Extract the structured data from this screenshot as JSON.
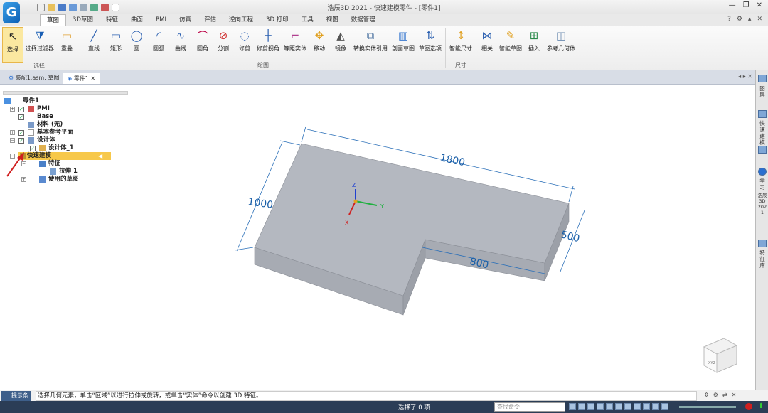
{
  "app": {
    "title": "浩辰3D 2021 - 快速建模零件 - [零件1]",
    "logo_letter": "G"
  },
  "menu_tabs": [
    "草图",
    "3D草图",
    "特征",
    "曲面",
    "PMI",
    "仿真",
    "评估",
    "逆向工程",
    "3D 打印",
    "工具",
    "视图",
    "数据管理"
  ],
  "ribbon": {
    "tools": [
      "选择",
      "选择过滤器",
      "重叠",
      "直线",
      "矩形",
      "圆",
      "圆弧",
      "曲线",
      "圆角",
      "分割",
      "修剪",
      "修剪拐角",
      "等距实体",
      "移动",
      "镜像",
      "转换实体引用",
      "剖面草图",
      "草图选项",
      "智能尺寸",
      "相关",
      "智能草图",
      "插入",
      "参考几何体"
    ],
    "groups": [
      "选择",
      "绘图",
      "尺寸"
    ]
  },
  "doc_tabs": [
    "装配1.asm: 草图",
    "零件1"
  ],
  "tree": {
    "nodes": [
      "零件1",
      "PMI",
      "Base",
      "材料 (无)",
      "基本参考平面",
      "设计体",
      "设计体_1",
      "快速建模",
      "特征",
      "拉伸 1",
      "使用的草图"
    ]
  },
  "viewport": {
    "dims": [
      "1800",
      "1000",
      "800",
      "500"
    ],
    "axes": [
      "Z",
      "Y",
      "X"
    ],
    "viewcube": "XYZ"
  },
  "right_panel": [
    "图层",
    "快速建模",
    "学习",
    "浩辰3D 2021",
    "特征库"
  ],
  "command": {
    "label": "提示条",
    "text": "选择几何元素，单击“区域”以进行拉伸或旋转，或单击“实体”命令以创建 3D 特征。"
  },
  "status": {
    "text": "选择了 0 项",
    "search_placeholder": "查找命令"
  },
  "colors": {
    "status_bar": "#2b3d56",
    "highlight": "#f7c84a",
    "part_face": "#b4b8c0"
  }
}
